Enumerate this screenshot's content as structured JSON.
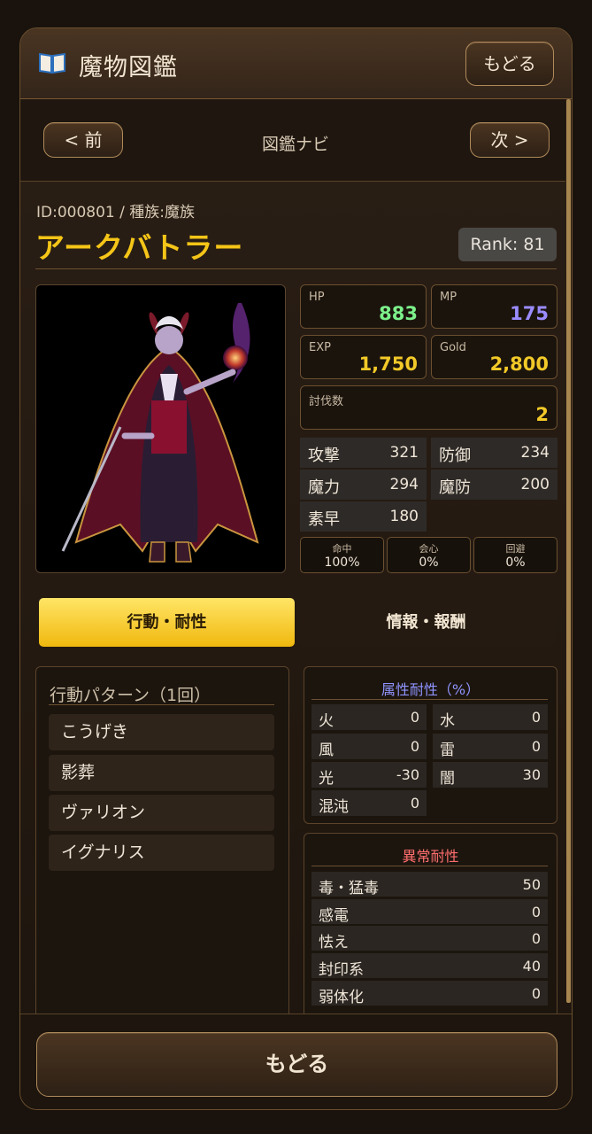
{
  "header": {
    "title": "魔物図鑑",
    "back_label": "もどる"
  },
  "nav": {
    "prev_label": "< 前",
    "title": "図鑑ナビ",
    "next_label": "次 >"
  },
  "monster": {
    "id_line": "ID:000801 / 種族:魔族",
    "name": "アークバトラー",
    "rank": "Rank: 81"
  },
  "stats_top": {
    "hp": {
      "label": "HP",
      "value": "883",
      "color": "#7cf08a"
    },
    "mp": {
      "label": "MP",
      "value": "175",
      "color": "#9a8cff"
    },
    "exp": {
      "label": "EXP",
      "value": "1,750",
      "color": "#f2c928"
    },
    "gold": {
      "label": "Gold",
      "value": "2,800",
      "color": "#f2c928"
    },
    "kills": {
      "label": "討伐数",
      "value": "2",
      "color": "#f2c928"
    }
  },
  "stats_grid": {
    "attack": {
      "label": "攻撃",
      "value": "321"
    },
    "defense": {
      "label": "防御",
      "value": "234"
    },
    "magic": {
      "label": "魔力",
      "value": "294"
    },
    "mdef": {
      "label": "魔防",
      "value": "200"
    },
    "speed": {
      "label": "素早",
      "value": "180"
    }
  },
  "rates": {
    "hit": {
      "label": "命中",
      "value": "100%"
    },
    "crit": {
      "label": "会心",
      "value": "0%"
    },
    "evade": {
      "label": "回避",
      "value": "0%"
    }
  },
  "tabs": {
    "active": "行動・耐性",
    "inactive": "情報・報酬"
  },
  "actions": {
    "title": "行動パターン（1回）",
    "items": [
      "こうげき",
      "影葬",
      "ヴァリオン",
      "イグナリス"
    ]
  },
  "element_res": {
    "title": "属性耐性（%）",
    "title_color": "#8f94ff",
    "cells": [
      {
        "label": "火",
        "value": "0"
      },
      {
        "label": "水",
        "value": "0"
      },
      {
        "label": "風",
        "value": "0"
      },
      {
        "label": "雷",
        "value": "0"
      },
      {
        "label": "光",
        "value": "-30"
      },
      {
        "label": "闇",
        "value": "30"
      },
      {
        "label": "混沌",
        "value": "0"
      }
    ]
  },
  "status_res": {
    "title": "異常耐性",
    "title_color": "#ff6e6e",
    "rows": [
      {
        "label": "毒・猛毒",
        "value": "50"
      },
      {
        "label": "感電",
        "value": "0"
      },
      {
        "label": "怯え",
        "value": "0"
      },
      {
        "label": "封印系",
        "value": "40"
      },
      {
        "label": "弱体化",
        "value": "0"
      }
    ]
  },
  "footer": {
    "back_label": "もどる"
  }
}
